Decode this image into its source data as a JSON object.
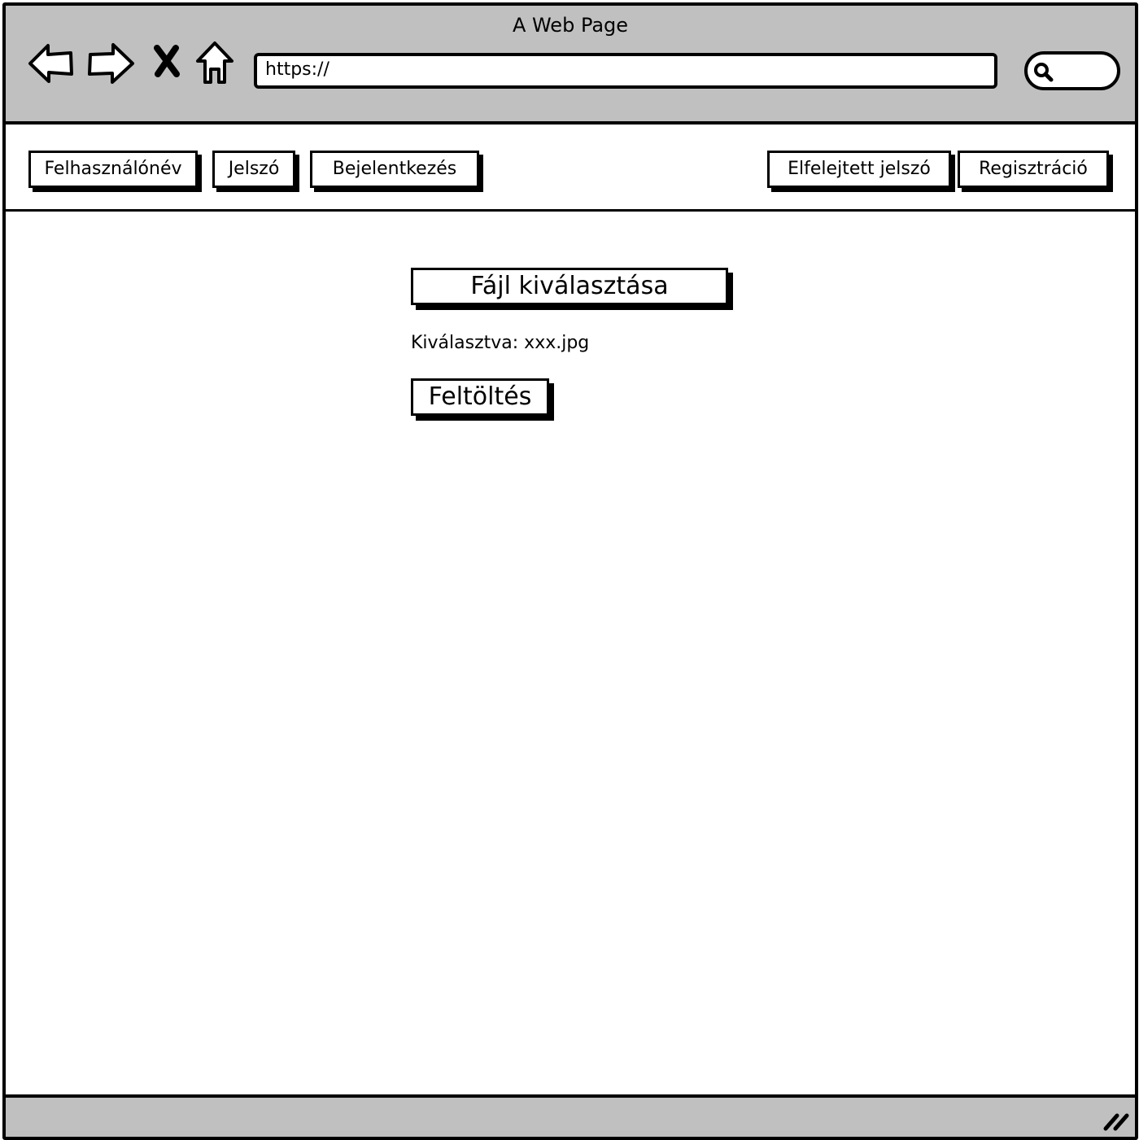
{
  "window": {
    "title": "A Web Page",
    "url": "https://"
  },
  "browser_icons": [
    "back-arrow-icon",
    "forward-arrow-icon",
    "close-x-icon",
    "home-icon",
    "search-icon",
    "resize-grip-icon"
  ],
  "topnav": {
    "username_label": "Felhasználónév",
    "password_label": "Jelszó",
    "login_label": "Bejelentkezés",
    "forgot_password_label": "Elfelejtett jelszó",
    "register_label": "Regisztráció"
  },
  "upload": {
    "choose_file_label": "Fájl kiválasztása",
    "selected_text": "Kiválasztva: xxx.jpg",
    "upload_label": "Feltöltés"
  },
  "colors": {
    "chrome_gray": "#c0c0c0",
    "ink": "#000000",
    "paper": "#ffffff"
  }
}
